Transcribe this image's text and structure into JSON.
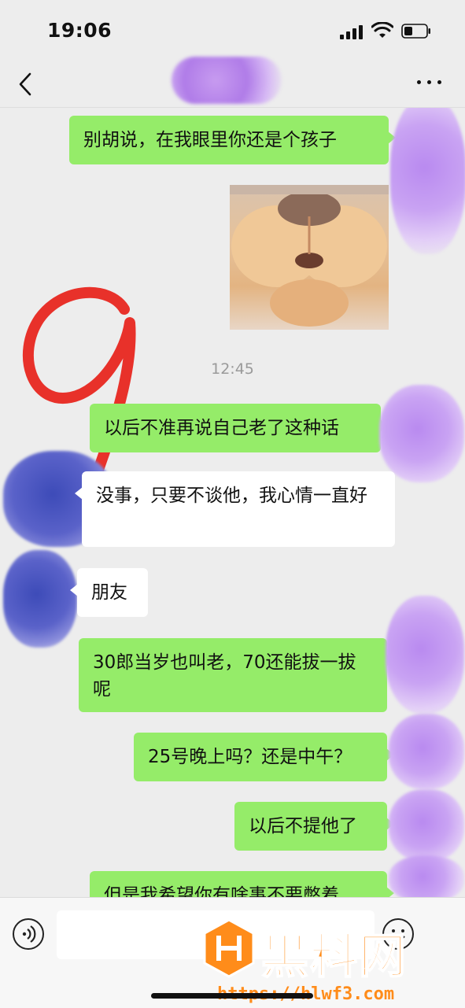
{
  "status": {
    "time": "19:06"
  },
  "chat": {
    "timestamp": "12:45",
    "messages": [
      {
        "side": "out",
        "text": "别胡说，在我眼里你还是个孩子"
      },
      {
        "side": "out",
        "type": "image",
        "description": "cat-mouth-photo"
      },
      {
        "side": "out",
        "text": "以后不准再说自己老了这种话"
      },
      {
        "side": "in",
        "text": "没事，只要不谈他，我心情一直好"
      },
      {
        "side": "in",
        "text": "朋友"
      },
      {
        "side": "out",
        "text": "30郎当岁也叫老，70还能拔一拔呢"
      },
      {
        "side": "out",
        "text": "25号晚上吗？还是中午？"
      },
      {
        "side": "out",
        "text": "以后不提他了"
      },
      {
        "side": "out",
        "text": "但是我希望你有啥事不要憋着"
      }
    ],
    "annotation": "9"
  },
  "input": {
    "placeholder": ""
  },
  "watermark": {
    "title": "黑料网",
    "url": "https://hlwf3.com"
  },
  "colors": {
    "outgoing_bubble": "#95ec69",
    "incoming_bubble": "#ffffff",
    "background": "#ededed",
    "watermark": "#ff8c1a"
  }
}
